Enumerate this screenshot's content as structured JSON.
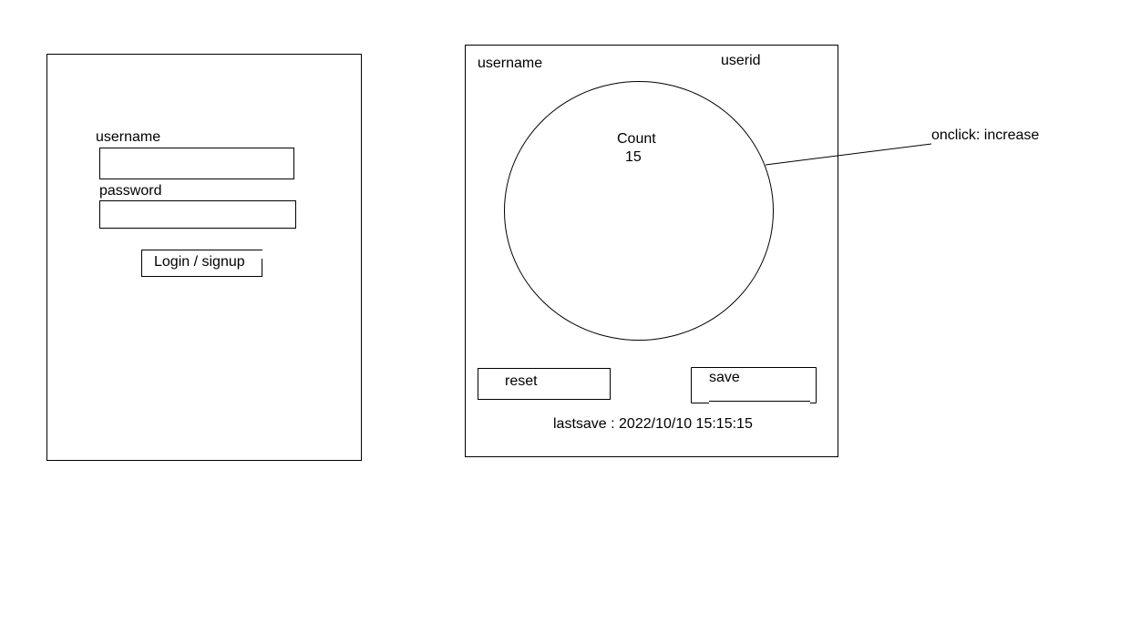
{
  "login_screen": {
    "username_label": "username",
    "password_label": "password",
    "username_value": "",
    "password_value": "",
    "submit_label": "Login / signup"
  },
  "counter_screen": {
    "username_label": "username",
    "userid_label": "userid",
    "count_label": "Count",
    "count_value": "15",
    "reset_label": "reset",
    "save_label": "save",
    "lastsave_text": "lastsave : 2022/10/10 15:15:15"
  },
  "annotation": {
    "onclick_note": "onclick: increase"
  }
}
